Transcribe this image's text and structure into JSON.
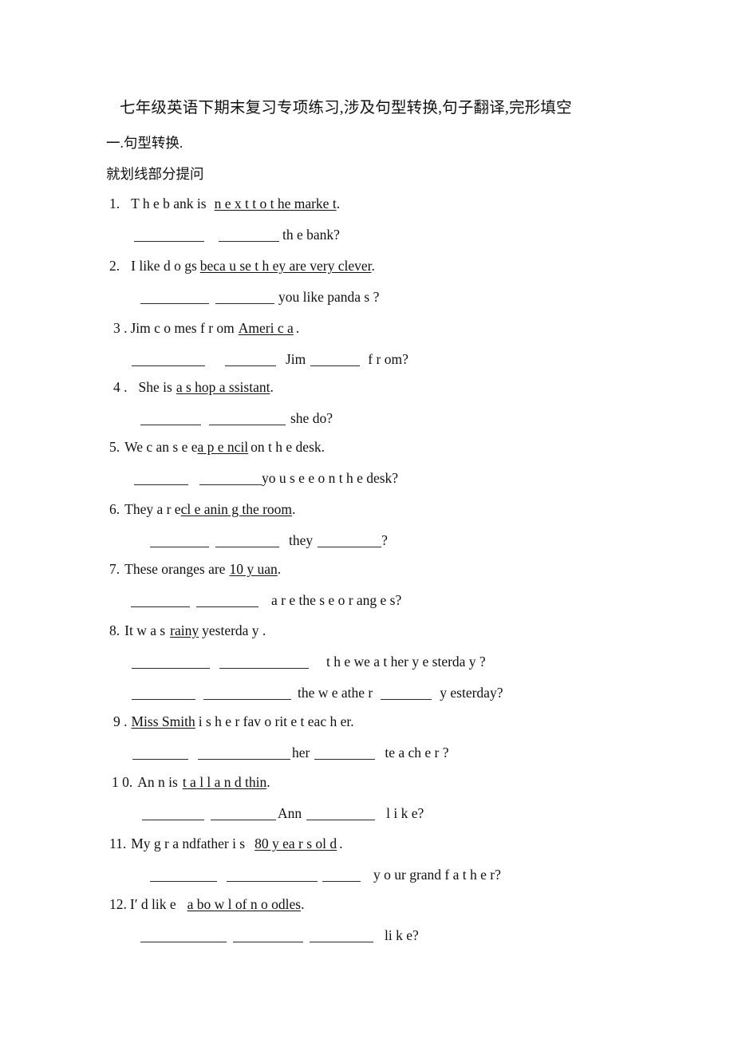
{
  "document": {
    "title": "七年级英语下期末复习专项练习,涉及句型转换,句子翻译,完形填空",
    "section_heading": "一.句型转换.",
    "section_instruction": "就划线部分提问"
  },
  "items": [
    {
      "number": "1.",
      "prompt_before": "T h e   b ank is",
      "prompt_underlined": "n e  x t t o    t  he marke t",
      "prompt_after": ".",
      "answers": [
        {
          "tail": "th e   bank?"
        }
      ]
    },
    {
      "number": "2.",
      "prompt_before": "I   like d o gs",
      "prompt_underlined": "beca u se t h ey are very clever",
      "prompt_after": ".",
      "answers": [
        {
          "tail": "you like panda s ?"
        }
      ]
    },
    {
      "number": "3 .",
      "prompt_before": "Jim   c  o mes f r om",
      "prompt_underlined": "Ameri c  a",
      "prompt_after": ".",
      "answers": [
        {
          "mid": "Jim",
          "tail": "f  r om?"
        }
      ]
    },
    {
      "number": "4 .",
      "prompt_before": "She is",
      "prompt_underlined": "a   s hop    a ssistant",
      "prompt_after": ".",
      "answers": [
        {
          "tail": "she do?"
        }
      ]
    },
    {
      "number": "5.",
      "prompt_before": "We   c an s e e",
      "prompt_underlined": "a   p e ncil",
      "prompt_after": "on t h e desk.",
      "answers": [
        {
          "tail": "yo u   s  e e o n  t h e desk?"
        }
      ]
    },
    {
      "number": "6.",
      "prompt_before": "They   a r e",
      "prompt_underlined": "cl e anin g    the   room",
      "prompt_after": ".",
      "answers": [
        {
          "mid": "they",
          "tail": "?"
        }
      ]
    },
    {
      "number": "7.",
      "prompt_before": "These oranges   are",
      "prompt_underlined": "10   y uan",
      "prompt_after": ".",
      "answers": [
        {
          "tail": "a r e  the s  e   o r ang e s?"
        }
      ]
    },
    {
      "number": "8.",
      "prompt_before": "It   w a  s",
      "prompt_underlined": "rainy",
      "prompt_after": "yesterda y .",
      "answers": [
        {
          "tail": "t  h e we a  t her  y  e sterda y ?"
        },
        {
          "mid": "the   w e athe r",
          "tail": "y esterday?"
        }
      ]
    },
    {
      "number": "9 .",
      "prompt_before": "",
      "prompt_underlined": "Miss Smith",
      "prompt_after": "i s   h  e r fav o rit e   t eac h er.",
      "answers": [
        {
          "mid": "her",
          "tail": "te a ch e  r ?"
        }
      ]
    },
    {
      "number": "1 0.",
      "prompt_before": "An n  is",
      "prompt_underlined": "t  a l l    a n d thin",
      "prompt_after": ".",
      "answers": [
        {
          "mid": "Ann",
          "tail": "l i k e?"
        }
      ]
    },
    {
      "number": "11.",
      "prompt_before": "My g r  a ndfather i s",
      "prompt_underlined": "80   y ea r s ol d",
      "prompt_after": ".",
      "answers": [
        {
          "tail": "y o ur   grand f a t h e r?"
        }
      ]
    },
    {
      "number": "12.",
      "prompt_before": "I′ d lik e",
      "prompt_underlined": "a   bo w l of n o odles",
      "prompt_after": ".",
      "answers": [
        {
          "tail": "li k e?"
        }
      ]
    }
  ]
}
